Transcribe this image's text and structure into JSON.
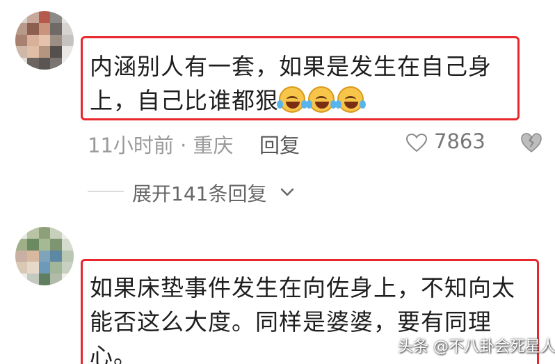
{
  "comments": [
    {
      "text_line1": "内涵别人有一套，如果是发生在自己身",
      "text_line2": "上，自己比谁都狠",
      "emoji": "laugh-cry-emoji",
      "emoji_count": 3,
      "time_location": "11小时前 · 重庆",
      "reply_label": "回复",
      "like_count": "7863"
    },
    {
      "text_line1": "如果床垫事件发生在向佐身上，不知向太",
      "text_line2": "能否这么大度。同样是婆婆，要有同理",
      "text_line3": "心。"
    }
  ],
  "expand_replies": "展开141条回复",
  "watermark": "头条 @不八卦会死星人",
  "colors": {
    "highlight_border": "#e8262b",
    "meta_text": "#9a9a9a",
    "emoji_yellow": "#f6c54a"
  }
}
